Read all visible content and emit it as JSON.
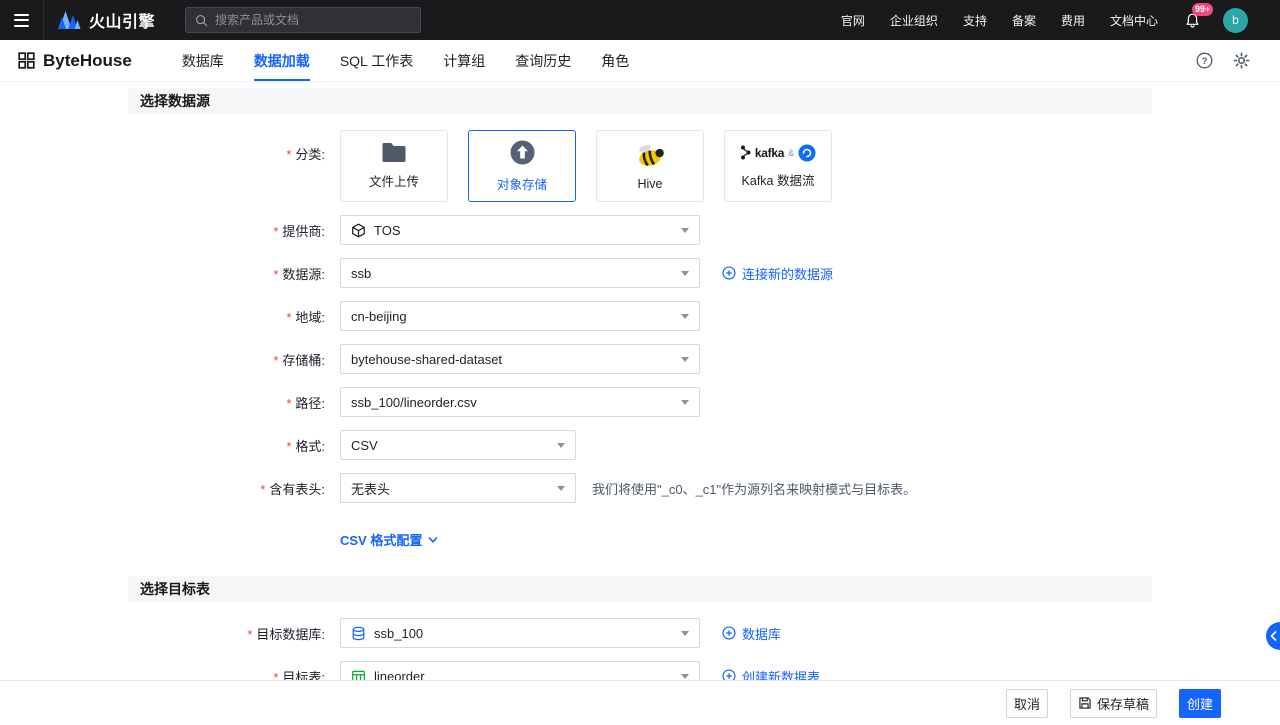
{
  "ui": {
    "required_marker": "*"
  },
  "colors": {
    "accent": "#1664ff",
    "badge": "#f5457b",
    "avatar_bg": "#2ba7a5"
  },
  "topbar": {
    "brand": "火山引擎",
    "search_placeholder": "搜索产品或文档",
    "links": [
      "官网",
      "企业组织",
      "支持",
      "备案",
      "费用",
      "文档中心"
    ],
    "notification_badge": "99+",
    "avatar_text": "b"
  },
  "navbar": {
    "brand": "ByteHouse",
    "tabs": [
      "数据库",
      "数据加载",
      "SQL 工作表",
      "计算组",
      "查询历史",
      "角色"
    ],
    "active_tab": "数据加载"
  },
  "source_section": {
    "title": "选择数据源",
    "category_label": "分类:",
    "categories": [
      {
        "label": "文件上传"
      },
      {
        "label": "对象存储",
        "selected": true
      },
      {
        "label": "Hive"
      },
      {
        "label": "Kafka 数据流",
        "logo_text": "kafka",
        "amp": "&"
      }
    ],
    "fields": {
      "provider": {
        "label": "提供商:",
        "value": "TOS"
      },
      "datasource": {
        "label": "数据源:",
        "value": "ssb",
        "action": "连接新的数据源"
      },
      "region": {
        "label": "地域:",
        "value": "cn-beijing"
      },
      "bucket": {
        "label": "存储桶:",
        "value": "bytehouse-shared-dataset"
      },
      "path": {
        "label": "路径:",
        "value": "ssb_100/lineorder.csv"
      },
      "format": {
        "label": "格式:",
        "value": "CSV"
      },
      "header": {
        "label": "含有表头:",
        "value": "无表头",
        "hint": "我们将使用\"_c0、_c1\"作为源列名来映射模式与目标表。"
      }
    },
    "csv_config_label": "CSV 格式配置"
  },
  "target_section": {
    "title": "选择目标表",
    "fields": {
      "database": {
        "label": "目标数据库:",
        "value": "ssb_100",
        "action": "数据库"
      },
      "table": {
        "label": "目标表:",
        "value": "lineorder",
        "action": "创建新数据表"
      }
    }
  },
  "footer": {
    "cancel": "取消",
    "save_draft": "保存草稿",
    "create": "创建"
  }
}
